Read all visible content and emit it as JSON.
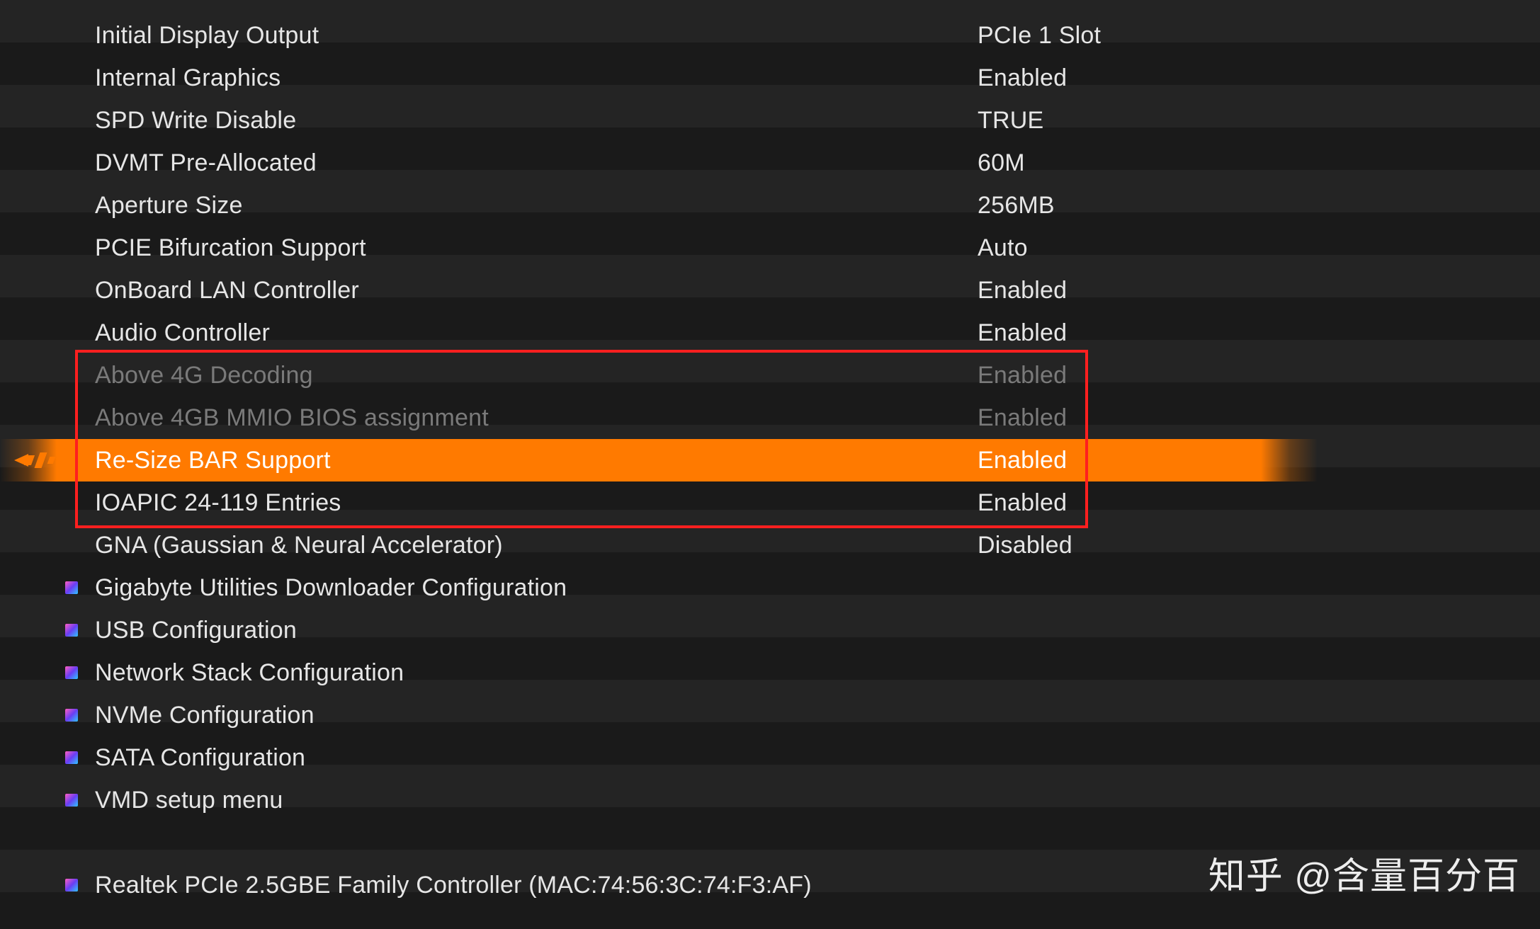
{
  "rows": [
    {
      "type": "setting",
      "label": "Initial Display Output",
      "value": "PCIe 1 Slot"
    },
    {
      "type": "setting",
      "label": "Internal Graphics",
      "value": "Enabled"
    },
    {
      "type": "setting",
      "label": "SPD Write Disable",
      "value": "TRUE"
    },
    {
      "type": "setting",
      "label": "DVMT Pre-Allocated",
      "value": "60M"
    },
    {
      "type": "setting",
      "label": "Aperture Size",
      "value": "256MB"
    },
    {
      "type": "setting",
      "label": "PCIE Bifurcation Support",
      "value": "Auto"
    },
    {
      "type": "setting",
      "label": "OnBoard LAN Controller",
      "value": "Enabled"
    },
    {
      "type": "setting",
      "label": "Audio Controller",
      "value": "Enabled"
    },
    {
      "type": "setting",
      "label": "Above 4G Decoding",
      "value": "Enabled",
      "dim": true
    },
    {
      "type": "setting",
      "label": "Above 4GB MMIO BIOS assignment",
      "value": "Enabled",
      "dim": true
    },
    {
      "type": "setting",
      "label": "Re-Size BAR Support",
      "value": "Enabled",
      "selected": true
    },
    {
      "type": "setting",
      "label": "IOAPIC 24-119 Entries",
      "value": "Enabled"
    },
    {
      "type": "setting",
      "label": "GNA (Gaussian & Neural Accelerator)",
      "value": "Disabled"
    },
    {
      "type": "menu",
      "label": "Gigabyte Utilities Downloader Configuration"
    },
    {
      "type": "menu",
      "label": "USB Configuration"
    },
    {
      "type": "menu",
      "label": "Network Stack Configuration"
    },
    {
      "type": "menu",
      "label": "NVMe Configuration"
    },
    {
      "type": "menu",
      "label": "SATA Configuration"
    },
    {
      "type": "menu",
      "label": "VMD setup menu"
    },
    {
      "type": "blank"
    },
    {
      "type": "menu",
      "label": "Realtek PCIe 2.5GBE Family Controller (MAC:74:56:3C:74:F3:AF)"
    }
  ],
  "annotation": {
    "first_row_index": 8,
    "last_row_index": 11
  },
  "watermark": "知乎 @含量百分百"
}
